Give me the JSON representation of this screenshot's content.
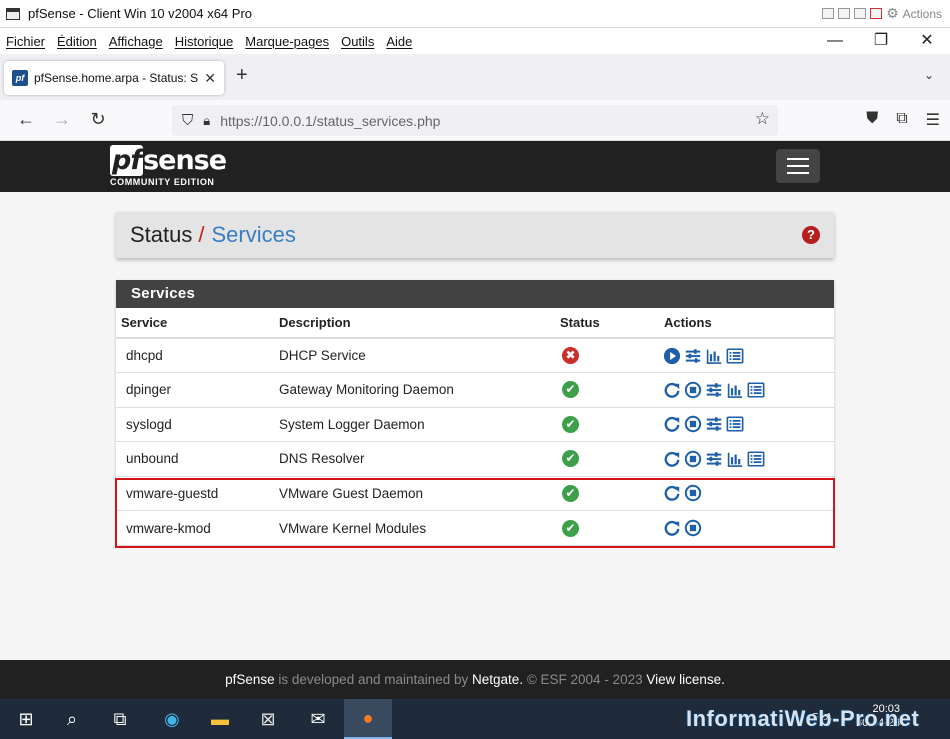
{
  "vm_window": {
    "title": "pfSense - Client Win 10 v2004 x64 Pro",
    "actions_label": "Actions"
  },
  "menubar": {
    "items": [
      "Fichier",
      "Édition",
      "Affichage",
      "Historique",
      "Marque-pages",
      "Outils",
      "Aide"
    ]
  },
  "browser": {
    "tab_title": "pfSense.home.arpa - Status: Ser",
    "url": "https://10.0.0.1/status_services.php"
  },
  "pf_header": {
    "logo_text": "sense",
    "logo_prefix": "pf",
    "edition": "COMMUNITY EDITION"
  },
  "breadcrumb": {
    "part1": "Status",
    "separator": "/",
    "part2": "Services"
  },
  "services_panel": {
    "heading": "Services",
    "columns": [
      "Service",
      "Description",
      "Status",
      "Actions"
    ],
    "rows": [
      {
        "service": "dhcpd",
        "description": "DHCP Service",
        "status": "stopped",
        "actions": [
          "start",
          "settings",
          "graph",
          "logs"
        ]
      },
      {
        "service": "dpinger",
        "description": "Gateway Monitoring Daemon",
        "status": "running",
        "actions": [
          "restart",
          "stop",
          "settings",
          "graph",
          "logs"
        ]
      },
      {
        "service": "syslogd",
        "description": "System Logger Daemon",
        "status": "running",
        "actions": [
          "restart",
          "stop",
          "settings",
          "logs"
        ]
      },
      {
        "service": "unbound",
        "description": "DNS Resolver",
        "status": "running",
        "actions": [
          "restart",
          "stop",
          "settings",
          "graph",
          "logs"
        ]
      },
      {
        "service": "vmware-guestd",
        "description": "VMware Guest Daemon",
        "status": "running",
        "actions": [
          "restart",
          "stop"
        ]
      },
      {
        "service": "vmware-kmod",
        "description": "VMware Kernel Modules",
        "status": "running",
        "actions": [
          "restart",
          "stop"
        ]
      }
    ]
  },
  "footer": {
    "brand": "pfSense",
    "text1": " is developed and maintained by ",
    "company": "Netgate.",
    "text2": " © ESF 2004 - 2023 ",
    "license": "View license."
  },
  "taskbar": {
    "time": "20:03",
    "date": "30-04-23",
    "lang": "FRA"
  },
  "watermark": "InformatiWeb-Pro.net",
  "colors": {
    "accent": "#3a7ec1",
    "ok": "#3c9f4a",
    "error": "#c9302c",
    "highlight": "#d3141b",
    "header": "#212121"
  }
}
